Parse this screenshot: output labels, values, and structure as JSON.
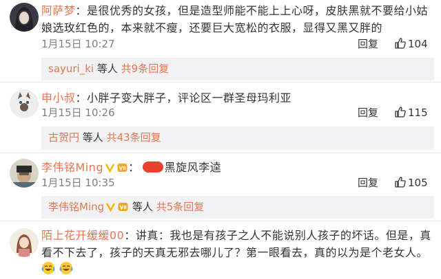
{
  "comments": [
    {
      "username": "阿萨梦",
      "text_line1": "是很优秀的女孩，但是造型师能不能上上心呀，皮肤黑就不要给小姑",
      "text_line2": "娘选玫红色的，本来就不瘦，还要巨大宽松的衣服，显得又黑又胖的",
      "timestamp": "1月15日 10:27",
      "reply_label": "回复",
      "likes": "104",
      "sub_user": "sayuri_ki",
      "sub_etc": "等人",
      "sub_more": "共9条回复"
    },
    {
      "username": "申小叔",
      "text_line1": "小胖子变大胖子，评论区一群圣母玛利亚",
      "timestamp": "1月15日 10:26",
      "reply_label": "回复",
      "likes": "115",
      "sub_user": "古贺円",
      "sub_etc": "等人",
      "sub_more": "共43条回复"
    },
    {
      "username": "李伟铭Ming",
      "text_line1": "黑旋风李逵",
      "timestamp": "1月15日 10:35",
      "reply_label": "回复",
      "likes": "105",
      "sub_user": "李伟铭Ming",
      "sub_etc": "等人",
      "sub_more": "共5条回复"
    },
    {
      "username": "陌上花开缓缓00",
      "text_line1": "讲真：我也是有孩子之人不能说别人孩子的坏话。但是，真",
      "text_line2": "看不下去了，孩子的天真无邪去哪儿了？第一眼看去，真的以为是个老女人。"
    }
  ],
  "separator": "：",
  "icons": [
    "avatar",
    "thumbs-up-icon",
    "verified-v-icon",
    "vip-badge-icon",
    "laughing-crying-emoji"
  ],
  "colors": {
    "username": "#eb7350",
    "meta": "#808080",
    "subbox": "#f2f2f5"
  }
}
